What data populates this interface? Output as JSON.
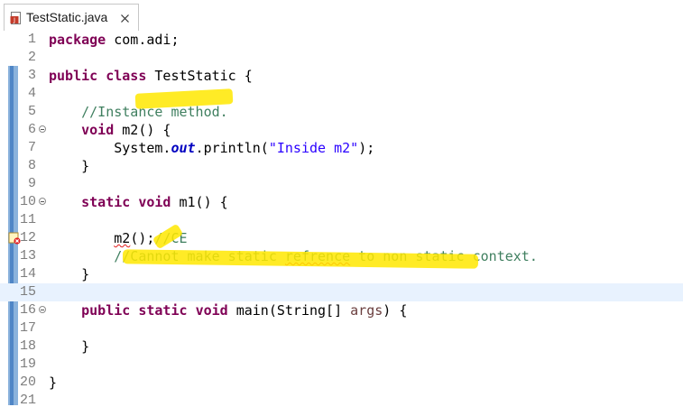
{
  "tab": {
    "title": "TestStatic.java",
    "file_icon": "java-file-icon",
    "close_icon": "close-icon"
  },
  "editor": {
    "current_line": 15,
    "lines": [
      {
        "n": "1",
        "parts": [
          {
            "t": "package",
            "c": "kw"
          },
          {
            "t": " com.adi;",
            "c": ""
          }
        ]
      },
      {
        "n": "2",
        "parts": []
      },
      {
        "n": "3",
        "parts": [
          {
            "t": "public",
            "c": "kw"
          },
          {
            "t": " ",
            "c": ""
          },
          {
            "t": "class",
            "c": "kw"
          },
          {
            "t": " TestStatic {",
            "c": ""
          }
        ]
      },
      {
        "n": "4",
        "parts": []
      },
      {
        "n": "5",
        "parts": [
          {
            "t": "    //Instance method.",
            "c": "cm"
          }
        ]
      },
      {
        "n": "6",
        "fold": true,
        "parts": [
          {
            "t": "    ",
            "c": ""
          },
          {
            "t": "void",
            "c": "kw"
          },
          {
            "t": " m2() {",
            "c": ""
          }
        ]
      },
      {
        "n": "7",
        "parts": [
          {
            "t": "        System.",
            "c": ""
          },
          {
            "t": "out",
            "c": "field"
          },
          {
            "t": ".println(",
            "c": ""
          },
          {
            "t": "\"Inside m2\"",
            "c": "str"
          },
          {
            "t": ");",
            "c": ""
          }
        ]
      },
      {
        "n": "8",
        "parts": [
          {
            "t": "    }",
            "c": ""
          }
        ]
      },
      {
        "n": "9",
        "parts": []
      },
      {
        "n": "10",
        "fold": true,
        "parts": [
          {
            "t": "    ",
            "c": ""
          },
          {
            "t": "static",
            "c": "kw"
          },
          {
            "t": " ",
            "c": ""
          },
          {
            "t": "void",
            "c": "kw"
          },
          {
            "t": " m1() {",
            "c": ""
          }
        ]
      },
      {
        "n": "11",
        "parts": []
      },
      {
        "n": "12",
        "error": true,
        "parts": [
          {
            "t": "        ",
            "c": ""
          },
          {
            "t": "m2",
            "c": "err"
          },
          {
            "t": "();",
            "c": ""
          },
          {
            "t": "//CE",
            "c": "cm"
          }
        ]
      },
      {
        "n": "13",
        "parts": [
          {
            "t": "        //Cannot make static ",
            "c": "cm"
          },
          {
            "t": "refrence",
            "c": "cm err"
          },
          {
            "t": " to non static context.",
            "c": "cm"
          }
        ]
      },
      {
        "n": "14",
        "parts": [
          {
            "t": "    }",
            "c": ""
          }
        ]
      },
      {
        "n": "15",
        "parts": []
      },
      {
        "n": "16",
        "fold": true,
        "parts": [
          {
            "t": "    ",
            "c": ""
          },
          {
            "t": "public",
            "c": "kw"
          },
          {
            "t": " ",
            "c": ""
          },
          {
            "t": "static",
            "c": "kw"
          },
          {
            "t": " ",
            "c": ""
          },
          {
            "t": "void",
            "c": "kw"
          },
          {
            "t": " main(String[] ",
            "c": ""
          },
          {
            "t": "args",
            "c": "arg"
          },
          {
            "t": ") {",
            "c": ""
          }
        ]
      },
      {
        "n": "17",
        "parts": []
      },
      {
        "n": "18",
        "parts": [
          {
            "t": "    }",
            "c": ""
          }
        ]
      },
      {
        "n": "19",
        "parts": []
      },
      {
        "n": "20",
        "parts": [
          {
            "t": "}",
            "c": ""
          }
        ]
      },
      {
        "n": "21",
        "parts": []
      }
    ]
  },
  "colors": {
    "keyword": "#7f0055",
    "comment": "#3f7f5f",
    "string": "#2a00ff",
    "field": "#0000c0",
    "highlight": "#ffe800",
    "current_line": "#e8f2fe"
  }
}
